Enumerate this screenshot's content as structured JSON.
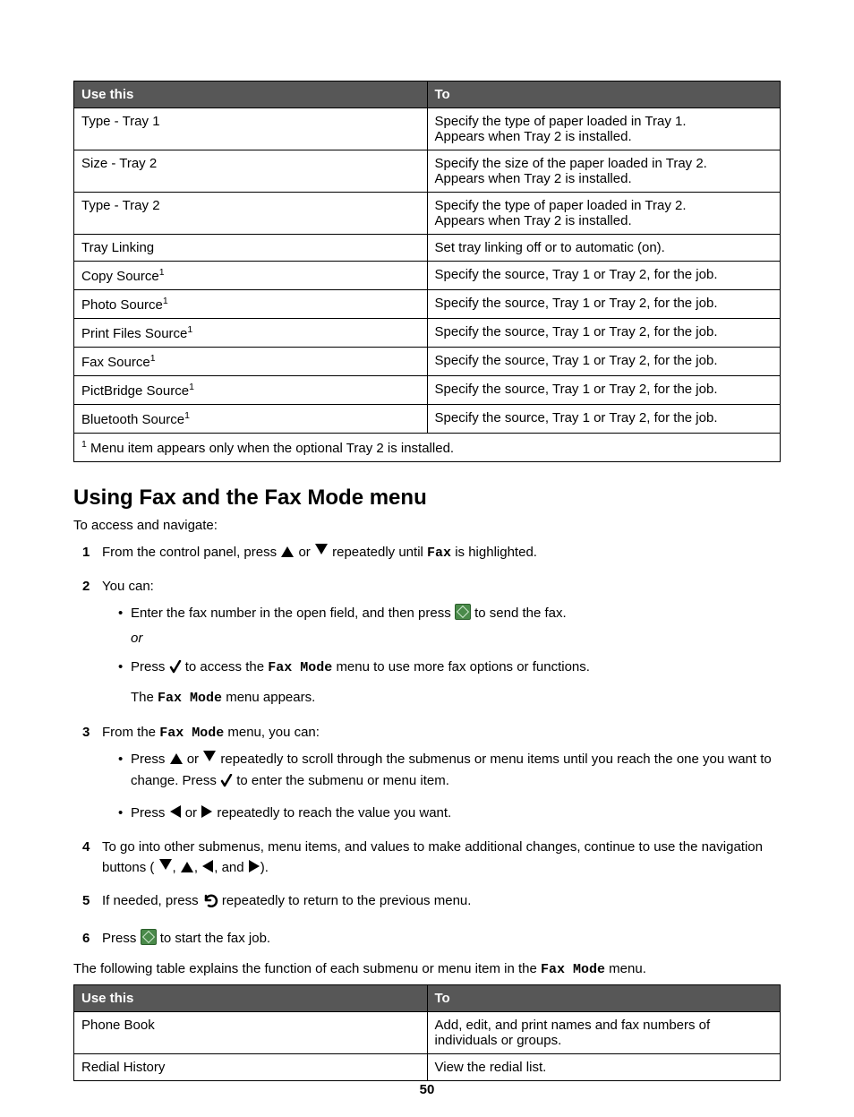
{
  "table1": {
    "headers": {
      "col1": "Use this",
      "col2": "To"
    },
    "rows": [
      {
        "use": "Type - Tray 1",
        "to": "Specify the type of paper loaded in Tray 1. Appears when Tray 2 is installed."
      },
      {
        "use": "Size - Tray 2",
        "to": "Specify the size of the paper loaded in Tray 2. Appears when Tray 2 is installed."
      },
      {
        "use": "Type - Tray 2",
        "to": "Specify the type of paper loaded in Tray 2. Appears when Tray 2 is installed."
      },
      {
        "use": "Tray Linking",
        "to": "Set tray linking off or to automatic (on)."
      },
      {
        "use_base": "Copy Source",
        "sup": "1",
        "to": "Specify the source, Tray 1 or Tray 2, for the job."
      },
      {
        "use_base": "Photo Source",
        "sup": "1",
        "to": "Specify the source, Tray 1 or Tray 2, for the job."
      },
      {
        "use_base": "Print Files Source",
        "sup": "1",
        "to": "Specify the source, Tray 1 or Tray 2, for the job."
      },
      {
        "use_base": "Fax Source",
        "sup": "1",
        "to": "Specify the source, Tray 1 or Tray 2, for the job."
      },
      {
        "use_base": "PictBridge Source",
        "sup": "1",
        "to": "Specify the source, Tray 1 or Tray 2, for the job."
      },
      {
        "use_base": "Bluetooth Source",
        "sup": "1",
        "to": "Specify the source, Tray 1 or Tray 2, for the job."
      }
    ],
    "footnote": {
      "sup": "1",
      "text": " Menu item appears only when the optional Tray 2 is installed."
    }
  },
  "section": {
    "heading": "Using Fax and the Fax Mode menu",
    "lead": "To access and navigate:",
    "steps": {
      "s1": {
        "num": "1",
        "pre": "From the control panel, press ",
        "mid": " or ",
        "post1": " repeatedly until ",
        "fax": "Fax",
        "post2": " is highlighted."
      },
      "s2": {
        "num": "2",
        "intro": "You can:",
        "b1_pre": "Enter the fax number in the open field, and then press ",
        "b1_post": " to send the fax.",
        "or": "or",
        "b2_pre": "Press ",
        "b2_mid": " to access the ",
        "b2_mono": "Fax Mode",
        "b2_post": " menu to use more fax options or functions.",
        "b2_line2_pre": "The ",
        "b2_line2_mono": "Fax Mode",
        "b2_line2_post": " menu appears."
      },
      "s3": {
        "num": "3",
        "intro_pre": "From the ",
        "intro_mono": "Fax Mode",
        "intro_post": " menu, you can:",
        "b1_pre": "Press ",
        "b1_mid": " or ",
        "b1_post": " repeatedly to scroll through the submenus or menu items until you reach the one you want to change. Press ",
        "b1_post2": " to enter the submenu or menu item.",
        "b2_pre": "Press ",
        "b2_mid": " or ",
        "b2_post": " repeatedly to reach the value you want."
      },
      "s4": {
        "num": "4",
        "pre": "To go into other submenus, menu items, and values to make additional changes, continue to use the navigation buttons (",
        "sep": ", ",
        "and": ", and ",
        "post": ")."
      },
      "s5": {
        "num": "5",
        "pre": "If needed, press ",
        "post": " repeatedly to return to the previous menu."
      },
      "s6": {
        "num": "6",
        "pre": "Press ",
        "post": " to start the fax job."
      }
    },
    "after_pre": "The following table explains the function of each submenu or menu item in the ",
    "after_mono": "Fax Mode",
    "after_post": " menu."
  },
  "table2": {
    "headers": {
      "col1": "Use this",
      "col2": "To"
    },
    "rows": [
      {
        "use": "Phone Book",
        "to": "Add, edit, and print names and fax numbers of individuals or groups."
      },
      {
        "use": "Redial History",
        "to": "View the redial list."
      }
    ]
  },
  "page_number": "50"
}
